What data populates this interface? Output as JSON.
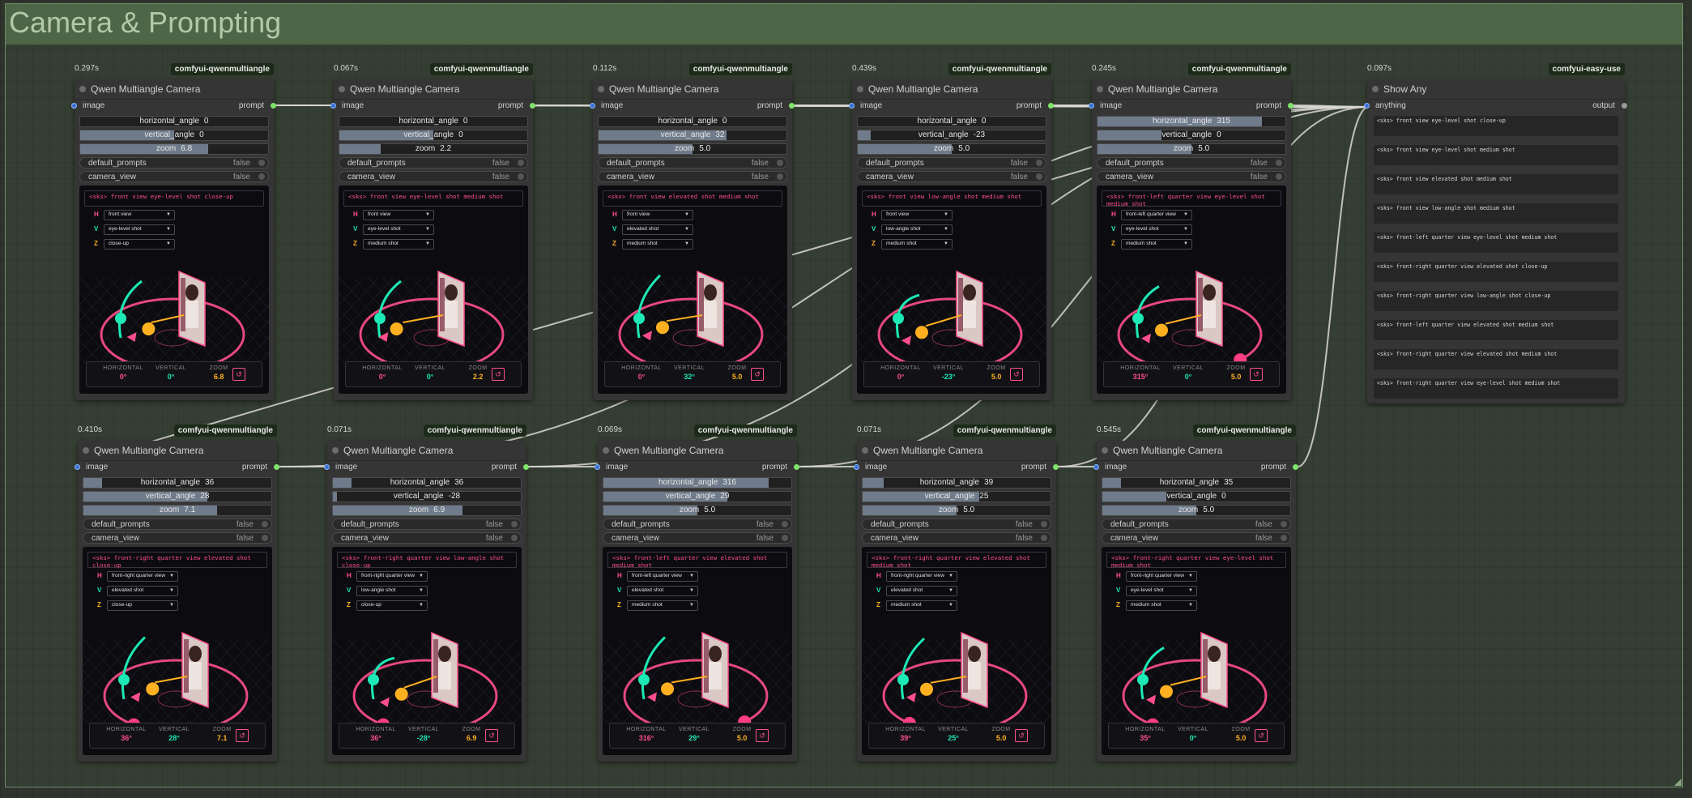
{
  "group": {
    "title": "Camera & Prompting"
  },
  "qwen_nodes": [
    {
      "time": "0.297s",
      "badge": "comfyui-qwenmultiangle",
      "title": "Qwen Multiangle Camera",
      "input": "image",
      "output": "prompt",
      "h_label": "horizontal_angle",
      "h": "0",
      "v_label": "vertical_angle",
      "v": "0",
      "z_label": "zoom",
      "z": "6.8",
      "h_frac": 0,
      "v_frac": 0.5,
      "z_frac": 0.68,
      "dp_label": "default_prompts",
      "dp": "false",
      "cv_label": "camera_view",
      "cv": "false",
      "prompt_text": "<sks> front view eye-level shot close-up",
      "sel_h": "front view",
      "sel_v": "eye-level shot",
      "sel_z": "close-up",
      "info_h_label": "HORIZONTAL",
      "info_h": "0°",
      "info_v_label": "VERTICAL",
      "info_v": "0°",
      "info_z_label": "ZOOM",
      "info_z": "6.8",
      "reset_icon": "↺"
    },
    {
      "time": "0.067s",
      "badge": "comfyui-qwenmultiangle",
      "title": "Qwen Multiangle Camera",
      "input": "image",
      "output": "prompt",
      "h_label": "horizontal_angle",
      "h": "0",
      "v_label": "vertical_angle",
      "v": "0",
      "z_label": "zoom",
      "z": "2.2",
      "h_frac": 0,
      "v_frac": 0.5,
      "z_frac": 0.22,
      "dp_label": "default_prompts",
      "dp": "false",
      "cv_label": "camera_view",
      "cv": "false",
      "prompt_text": "<sks> front view eye-level shot medium shot",
      "sel_h": "front view",
      "sel_v": "eye-level shot",
      "sel_z": "medium shot",
      "info_h_label": "HORIZONTAL",
      "info_h": "0°",
      "info_v_label": "VERTICAL",
      "info_v": "0°",
      "info_z_label": "ZOOM",
      "info_z": "2.2",
      "reset_icon": "↺"
    },
    {
      "time": "0.112s",
      "badge": "comfyui-qwenmultiangle",
      "title": "Qwen Multiangle Camera",
      "input": "image",
      "output": "prompt",
      "h_label": "horizontal_angle",
      "h": "0",
      "v_label": "vertical_angle",
      "v": "32",
      "z_label": "zoom",
      "z": "5.0",
      "h_frac": 0,
      "v_frac": 0.68,
      "z_frac": 0.5,
      "dp_label": "default_prompts",
      "dp": "false",
      "cv_label": "camera_view",
      "cv": "false",
      "prompt_text": "<sks> front view elevated shot medium shot",
      "sel_h": "front view",
      "sel_v": "elevated shot",
      "sel_z": "medium shot",
      "info_h_label": "HORIZONTAL",
      "info_h": "0°",
      "info_v_label": "VERTICAL",
      "info_v": "32°",
      "info_z_label": "ZOOM",
      "info_z": "5.0",
      "reset_icon": "↺"
    },
    {
      "time": "0.439s",
      "badge": "comfyui-qwenmultiangle",
      "title": "Qwen Multiangle Camera",
      "input": "image",
      "output": "prompt",
      "h_label": "horizontal_angle",
      "h": "0",
      "v_label": "vertical_angle",
      "v": "-23",
      "z_label": "zoom",
      "z": "5.0",
      "h_frac": 0,
      "v_frac": 0.07,
      "z_frac": 0.5,
      "dp_label": "default_prompts",
      "dp": "false",
      "cv_label": "camera_view",
      "cv": "false",
      "prompt_text": "<sks> front view low-angle shot medium shot",
      "sel_h": "front view",
      "sel_v": "low-angle shot",
      "sel_z": "medium shot",
      "info_h_label": "HORIZONTAL",
      "info_h": "0°",
      "info_v_label": "VERTICAL",
      "info_v": "-23°",
      "info_z_label": "ZOOM",
      "info_z": "5.0",
      "reset_icon": "↺"
    },
    {
      "time": "0.245s",
      "badge": "comfyui-qwenmultiangle",
      "title": "Qwen Multiangle Camera",
      "input": "image",
      "output": "prompt",
      "h_label": "horizontal_angle",
      "h": "315",
      "v_label": "vertical_angle",
      "v": "0",
      "z_label": "zoom",
      "z": "5.0",
      "h_frac": 0.875,
      "v_frac": 0.34,
      "z_frac": 0.5,
      "dp_label": "default_prompts",
      "dp": "false",
      "cv_label": "camera_view",
      "cv": "false",
      "prompt_text": "<sks> front-left quarter view eye-level shot medium shot",
      "sel_h": "front-left quarter view",
      "sel_v": "eye-level shot",
      "sel_z": "medium shot",
      "info_h_label": "HORIZONTAL",
      "info_h": "315°",
      "info_v_label": "VERTICAL",
      "info_v": "0°",
      "info_z_label": "ZOOM",
      "info_z": "5.0",
      "reset_icon": "↺"
    },
    {
      "time": "0.410s",
      "badge": "comfyui-qwenmultiangle",
      "title": "Qwen Multiangle Camera",
      "input": "image",
      "output": "prompt",
      "h_label": "horizontal_angle",
      "h": "36",
      "v_label": "vertical_angle",
      "v": "28",
      "z_label": "zoom",
      "z": "7.1",
      "h_frac": 0.1,
      "v_frac": 0.66,
      "z_frac": 0.71,
      "dp_label": "default_prompts",
      "dp": "false",
      "cv_label": "camera_view",
      "cv": "false",
      "prompt_text": "<sks> front-right quarter view elevated shot close-up",
      "sel_h": "front-right quarter view",
      "sel_v": "elevated shot",
      "sel_z": "close-up",
      "info_h_label": "HORIZONTAL",
      "info_h": "36°",
      "info_v_label": "VERTICAL",
      "info_v": "28°",
      "info_z_label": "ZOOM",
      "info_z": "7.1",
      "reset_icon": "↺"
    },
    {
      "time": "0.071s",
      "badge": "comfyui-qwenmultiangle",
      "title": "Qwen Multiangle Camera",
      "input": "image",
      "output": "prompt",
      "h_label": "horizontal_angle",
      "h": "36",
      "v_label": "vertical_angle",
      "v": "-28",
      "z_label": "zoom",
      "z": "6.9",
      "h_frac": 0.1,
      "v_frac": 0.02,
      "z_frac": 0.69,
      "dp_label": "default_prompts",
      "dp": "false",
      "cv_label": "camera_view",
      "cv": "false",
      "prompt_text": "<sks> front-right quarter view low-angle shot close-up",
      "sel_h": "front-right quarter view",
      "sel_v": "low-angle shot",
      "sel_z": "close-up",
      "info_h_label": "HORIZONTAL",
      "info_h": "36°",
      "info_v_label": "VERTICAL",
      "info_v": "-28°",
      "info_z_label": "ZOOM",
      "info_z": "6.9",
      "reset_icon": "↺"
    },
    {
      "time": "0.069s",
      "badge": "comfyui-qwenmultiangle",
      "title": "Qwen Multiangle Camera",
      "input": "image",
      "output": "prompt",
      "h_label": "horizontal_angle",
      "h": "316",
      "v_label": "vertical_angle",
      "v": "29",
      "z_label": "zoom",
      "z": "5.0",
      "h_frac": 0.88,
      "v_frac": 0.66,
      "z_frac": 0.5,
      "dp_label": "default_prompts",
      "dp": "false",
      "cv_label": "camera_view",
      "cv": "false",
      "prompt_text": "<sks> front-left quarter view elevated shot medium shot",
      "sel_h": "front-left quarter view",
      "sel_v": "elevated shot",
      "sel_z": "medium shot",
      "info_h_label": "HORIZONTAL",
      "info_h": "316°",
      "info_v_label": "VERTICAL",
      "info_v": "29°",
      "info_z_label": "ZOOM",
      "info_z": "5.0",
      "reset_icon": "↺"
    },
    {
      "time": "0.071s",
      "badge": "comfyui-qwenmultiangle",
      "title": "Qwen Multiangle Camera",
      "input": "image",
      "output": "prompt",
      "h_label": "horizontal_angle",
      "h": "39",
      "v_label": "vertical_angle",
      "v": "25",
      "z_label": "zoom",
      "z": "5.0",
      "h_frac": 0.11,
      "v_frac": 0.62,
      "z_frac": 0.5,
      "dp_label": "default_prompts",
      "dp": "false",
      "cv_label": "camera_view",
      "cv": "false",
      "prompt_text": "<sks> front-right quarter view elevated shot medium shot",
      "sel_h": "front-right quarter view",
      "sel_v": "elevated shot",
      "sel_z": "medium shot",
      "info_h_label": "HORIZONTAL",
      "info_h": "39°",
      "info_v_label": "VERTICAL",
      "info_v": "25°",
      "info_z_label": "ZOOM",
      "info_z": "5.0",
      "reset_icon": "↺"
    },
    {
      "time": "0.545s",
      "badge": "comfyui-qwenmultiangle",
      "title": "Qwen Multiangle Camera",
      "input": "image",
      "output": "prompt",
      "h_label": "horizontal_angle",
      "h": "35",
      "v_label": "vertical_angle",
      "v": "0",
      "z_label": "zoom",
      "z": "5.0",
      "h_frac": 0.1,
      "v_frac": 0.34,
      "z_frac": 0.5,
      "dp_label": "default_prompts",
      "dp": "false",
      "cv_label": "camera_view",
      "cv": "false",
      "prompt_text": "<sks> front-right quarter view eye-level shot medium shot",
      "sel_h": "front-right quarter view",
      "sel_v": "eye-level shot",
      "sel_z": "medium shot",
      "info_h_label": "HORIZONTAL",
      "info_h": "35°",
      "info_v_label": "VERTICAL",
      "info_v": "0°",
      "info_z_label": "ZOOM",
      "info_z": "5.0",
      "reset_icon": "↺"
    }
  ],
  "show_any": {
    "time": "0.097s",
    "badge": "comfyui-easy-use",
    "title": "Show Any",
    "input": "anything",
    "output": "output",
    "lines": [
      "<sks> front view eye-level shot close-up",
      "<sks> front view eye-level shot medium shot",
      "<sks> front view elevated shot medium shot",
      "<sks> front view low-angle shot medium shot",
      "<sks> front-left quarter view eye-level shot medium shot",
      "<sks> front-right quarter view elevated shot close-up",
      "<sks> front-right quarter view low-angle shot close-up",
      "<sks> front-left quarter view elevated shot medium shot",
      "<sks> front-right quarter view elevated shot medium shot",
      "<sks> front-right quarter view eye-level shot medium shot"
    ]
  },
  "select_letters": {
    "h": "H",
    "v": "V",
    "z": "Z"
  },
  "colors": {
    "accent_pink": "#ff4f8b",
    "accent_teal": "#1de9b6",
    "accent_gold": "#ffb020",
    "socket_green": "#7ee36a",
    "group_header": "#4c6647"
  },
  "icons": {
    "reset": "reset-icon",
    "node_status": "circle-icon"
  }
}
